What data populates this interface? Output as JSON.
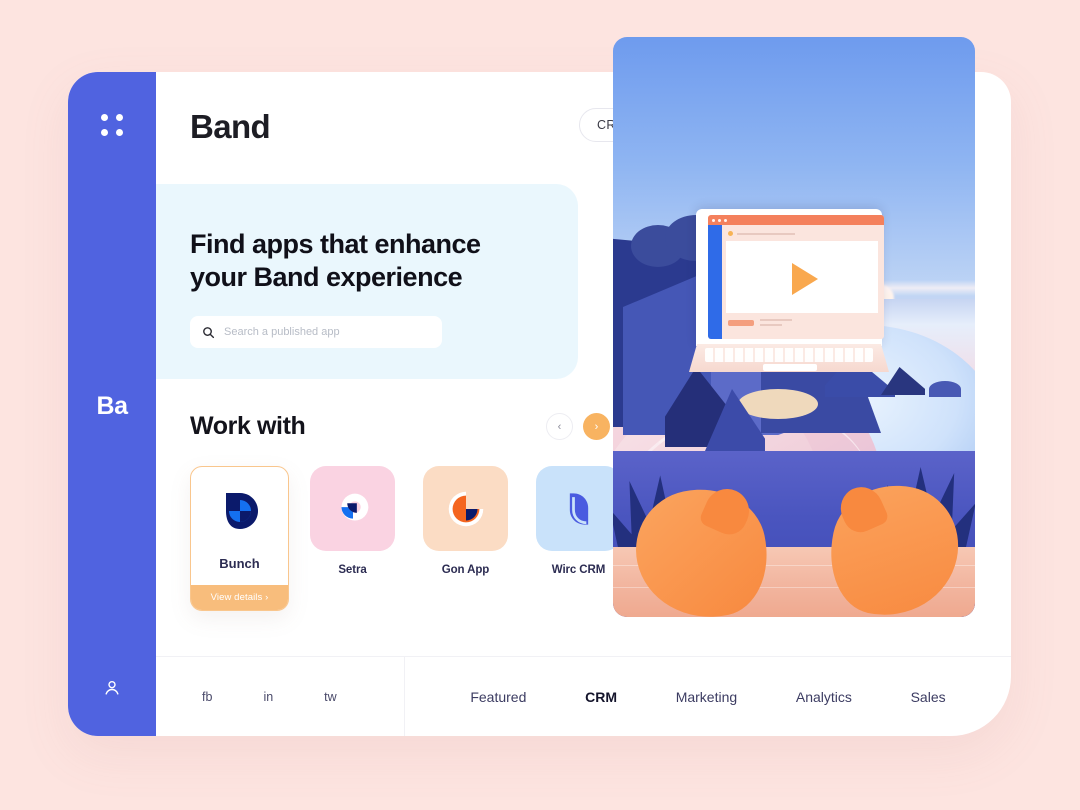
{
  "sidebar": {
    "grid_icon": "grid-dots-icon",
    "brand_short": "Ba",
    "user_icon": "user-icon"
  },
  "header": {
    "title": "Band",
    "category_selector": {
      "label": "CRM",
      "chevron": "chevron-down-icon"
    }
  },
  "hero": {
    "heading_line1": "Find apps that enhance",
    "heading_line2": "your Band experience",
    "search": {
      "icon": "search-icon",
      "placeholder": "Search a published app",
      "value": ""
    },
    "background_color": "#EAF7FD"
  },
  "work_with": {
    "title": "Work with",
    "prev_label": "‹",
    "next_label": "›",
    "featured": {
      "name": "Bunch",
      "cta": "View details  ›",
      "border_color": "#F9C68D",
      "cta_color": "#F8BD7C"
    },
    "apps": [
      {
        "name": "Setra",
        "bg": "#FAD3E2"
      },
      {
        "name": "Gon App",
        "bg": "#FBDCC4"
      },
      {
        "name": "Wirc CRM",
        "bg": "#C9E2FA"
      }
    ]
  },
  "footer": {
    "socials": [
      "fb",
      "in",
      "tw"
    ],
    "tabs": [
      {
        "label": "Featured",
        "active": false
      },
      {
        "label": "CRM",
        "active": true
      },
      {
        "label": "Marketing",
        "active": false
      },
      {
        "label": "Analytics",
        "active": false
      },
      {
        "label": "Sales",
        "active": false
      }
    ]
  },
  "illustration": {
    "alt": "coastal-sunset-scene-with-laptop-and-hands",
    "play_button": "play-icon"
  },
  "theme": {
    "page_background": "#FDE4E0",
    "sidebar_color": "#5063E0",
    "accent_orange": "#F8B361"
  }
}
